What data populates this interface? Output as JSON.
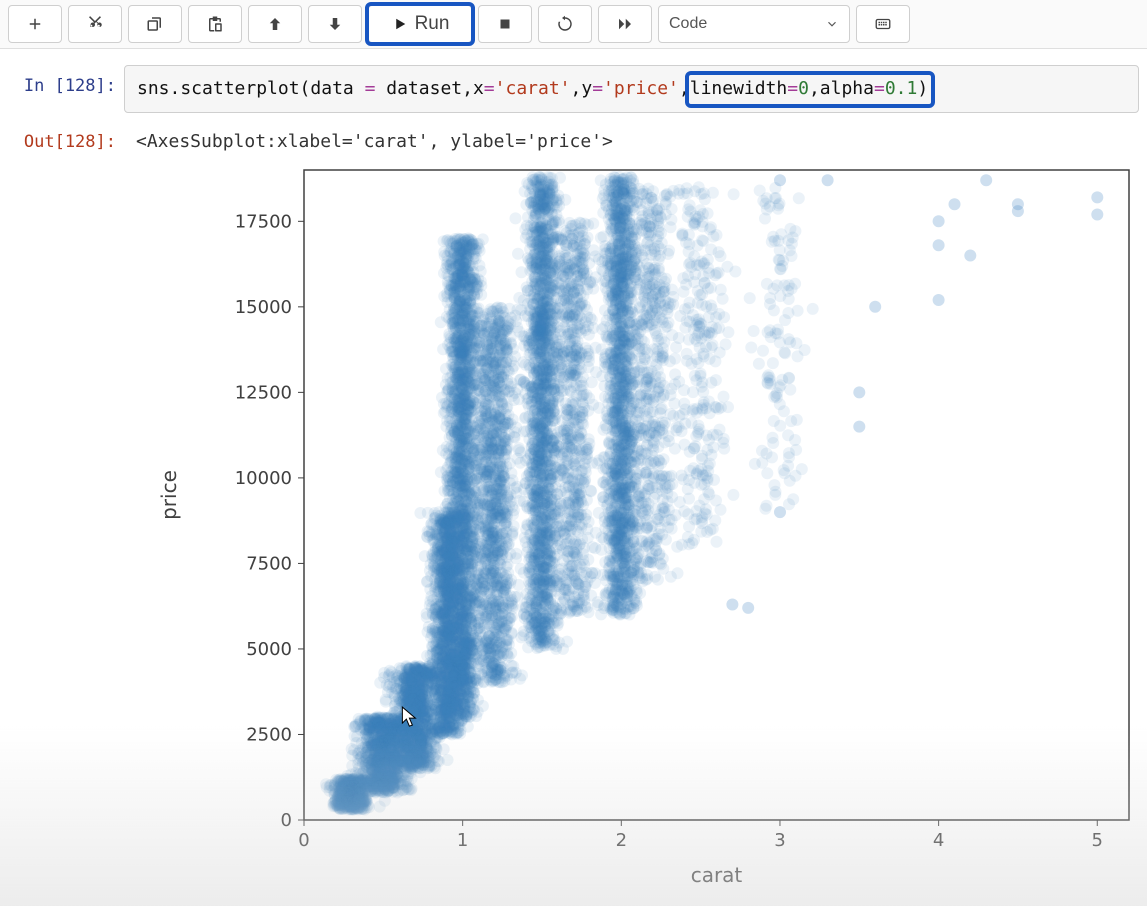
{
  "toolbar": {
    "run_label": "Run",
    "celltype": "Code"
  },
  "cell": {
    "exec": "128",
    "in_prompt": "In [128]:",
    "out_prompt": "Out[128]:",
    "code": {
      "p1": "sns.scatterplot(data ",
      "eq1": "=",
      "p2": " dataset,x",
      "eq2": "=",
      "s1": "'carat'",
      "p3": ",y",
      "eq3": "=",
      "s2": "'price'",
      "p4": ",linewidth",
      "eq4": "=",
      "n1": "0",
      "p5": ",alpha",
      "eq5": "=",
      "n2": "0.1",
      "p6": ")"
    },
    "out_text": "<AxesSubplot:xlabel='carat', ylabel='price'>"
  },
  "chart_data": {
    "type": "scatter",
    "title": "",
    "xlabel": "carat",
    "ylabel": "price",
    "xlim": [
      0,
      5.2
    ],
    "ylim": [
      0,
      19000
    ],
    "xticks": [
      0,
      1,
      2,
      3,
      4,
      5
    ],
    "yticks": [
      0,
      2500,
      5000,
      7500,
      10000,
      12500,
      15000,
      17500
    ],
    "alpha": 0.1,
    "color": "#3a7ebf",
    "marker_radius": 6,
    "dense_clusters": [
      {
        "x": 0.3,
        "y_lo": 300,
        "y_hi": 1200,
        "n": 500,
        "x_sd": 0.06
      },
      {
        "x": 0.5,
        "y_lo": 800,
        "y_hi": 3000,
        "n": 900,
        "x_sd": 0.08
      },
      {
        "x": 0.7,
        "y_lo": 1500,
        "y_hi": 4500,
        "n": 1000,
        "x_sd": 0.07
      },
      {
        "x": 0.9,
        "y_lo": 2500,
        "y_hi": 9000,
        "n": 1200,
        "x_sd": 0.05
      },
      {
        "x": 1.0,
        "y_lo": 3000,
        "y_hi": 17000,
        "n": 2200,
        "x_sd": 0.05
      },
      {
        "x": 1.2,
        "y_lo": 4000,
        "y_hi": 15000,
        "n": 1200,
        "x_sd": 0.06
      },
      {
        "x": 1.5,
        "y_lo": 5000,
        "y_hi": 18800,
        "n": 1800,
        "x_sd": 0.05
      },
      {
        "x": 1.7,
        "y_lo": 6000,
        "y_hi": 17500,
        "n": 700,
        "x_sd": 0.06
      },
      {
        "x": 2.0,
        "y_lo": 6000,
        "y_hi": 18800,
        "n": 1600,
        "x_sd": 0.05
      },
      {
        "x": 2.2,
        "y_lo": 7000,
        "y_hi": 18500,
        "n": 500,
        "x_sd": 0.07
      },
      {
        "x": 2.5,
        "y_lo": 8000,
        "y_hi": 18500,
        "n": 250,
        "x_sd": 0.08
      },
      {
        "x": 3.0,
        "y_lo": 9000,
        "y_hi": 18500,
        "n": 120,
        "x_sd": 0.08
      }
    ],
    "sparse_points": [
      {
        "x": 3.5,
        "y": 12500
      },
      {
        "x": 3.5,
        "y": 11500
      },
      {
        "x": 3.6,
        "y": 15000
      },
      {
        "x": 3.0,
        "y": 9000
      },
      {
        "x": 3.0,
        "y": 18700
      },
      {
        "x": 3.3,
        "y": 18700
      },
      {
        "x": 4.0,
        "y": 16800
      },
      {
        "x": 4.0,
        "y": 17500
      },
      {
        "x": 4.0,
        "y": 15200
      },
      {
        "x": 4.1,
        "y": 18000
      },
      {
        "x": 4.2,
        "y": 16500
      },
      {
        "x": 4.3,
        "y": 18700
      },
      {
        "x": 4.5,
        "y": 18000
      },
      {
        "x": 4.5,
        "y": 17800
      },
      {
        "x": 5.0,
        "y": 18200
      },
      {
        "x": 5.0,
        "y": 17700
      },
      {
        "x": 2.7,
        "y": 6300
      },
      {
        "x": 2.8,
        "y": 6200
      }
    ]
  },
  "cursor": {
    "carat": 0.62,
    "price": 3300
  }
}
